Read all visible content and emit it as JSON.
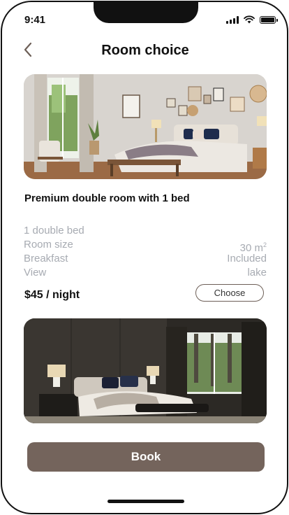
{
  "status_bar": {
    "time": "9:41"
  },
  "header": {
    "title": "Room choice"
  },
  "room": {
    "name": "Premium double room with 1 bed",
    "specs": [
      {
        "label": "1 double bed",
        "value": ""
      },
      {
        "label": "Room size",
        "value": "30 m",
        "unit_sup": "2"
      },
      {
        "label": "Breakfast",
        "value": "Included"
      },
      {
        "label": "View",
        "value": "lake"
      }
    ],
    "price": "$45 / night",
    "choose_label": "Choose"
  },
  "footer": {
    "book_label": "Book"
  },
  "colors": {
    "accent": "#74645c",
    "muted_text": "#a7abb2"
  }
}
